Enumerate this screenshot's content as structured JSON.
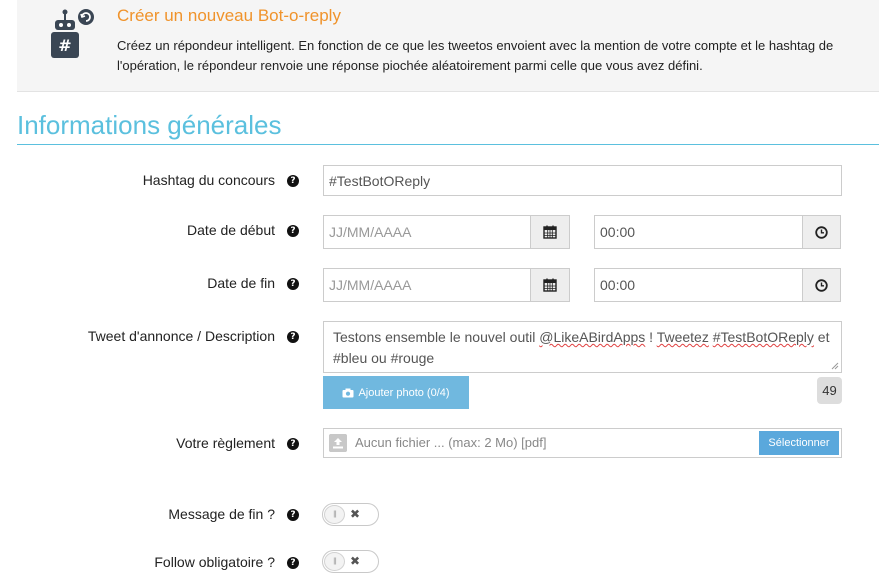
{
  "banner": {
    "icon": "bot-hashtag-icon",
    "title": "Créer un nouveau Bot-o-reply",
    "description": "Créez un répondeur intelligent. En fonction de ce que les tweetos envoient avec la mention de votre compte et le hashtag de l'opération, le répondeur renvoie une réponse piochée aléatoirement parmi celle que vous avez défini."
  },
  "section": {
    "title": "Informations générales"
  },
  "form": {
    "hashtag": {
      "label": "Hashtag du concours",
      "value": "#TestBotOReply"
    },
    "start_date": {
      "label": "Date de début",
      "date_placeholder": "JJ/MM/AAAA",
      "time_value": "00:00"
    },
    "end_date": {
      "label": "Date de fin",
      "date_placeholder": "JJ/MM/AAAA",
      "time_value": "00:00"
    },
    "tweet": {
      "label": "Tweet d'annonce / Description",
      "value_parts": [
        "Testons ensemble le nouvel outil ",
        "@LikeABirdApps",
        " ! ",
        "Tweetez",
        " ",
        "#TestBotOReply",
        " et #bleu ou #rouge"
      ],
      "photo_button": "Ajouter photo (0/4)",
      "char_count": "49"
    },
    "rules": {
      "label": "Votre règlement",
      "file_placeholder": "Aucun fichier ... (max: 2 Mo) [pdf]",
      "select_button": "Sélectionner"
    },
    "end_message": {
      "label": "Message de fin ?",
      "enabled": false
    },
    "follow_required": {
      "label": "Follow obligatoire ?",
      "enabled": false
    }
  },
  "help_glyph": "?",
  "colors": {
    "accent": "#5bc0de",
    "title_orange": "#f0932b",
    "button_blue": "#70b8df"
  }
}
